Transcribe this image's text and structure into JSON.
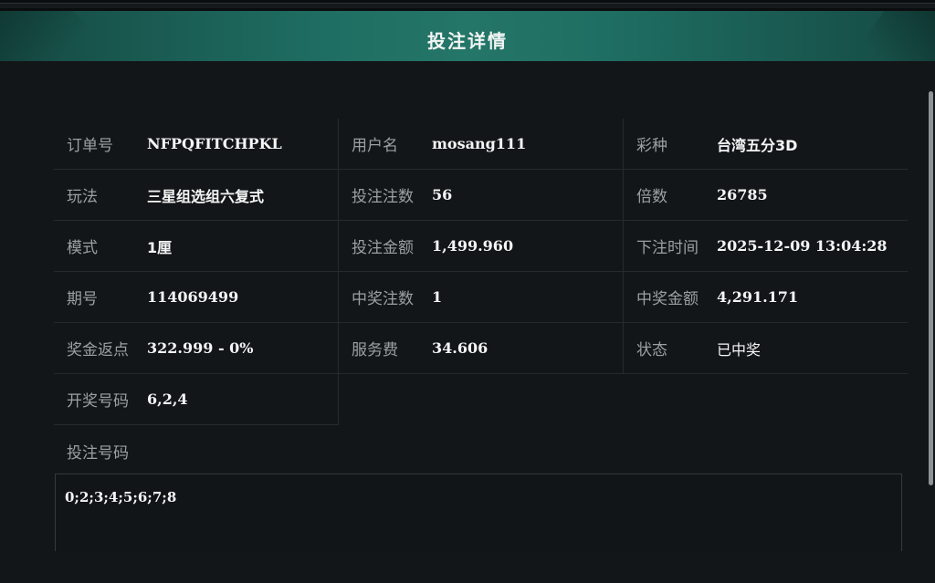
{
  "dialog": {
    "title": "投注详情"
  },
  "rows": [
    [
      {
        "label": "订单号",
        "value": "NFPQFITCHPKL"
      },
      {
        "label": "用户名",
        "value": "mosang111"
      },
      {
        "label": "彩种",
        "value": "台湾五分3D"
      }
    ],
    [
      {
        "label": "玩法",
        "value": "三星组选组六复式"
      },
      {
        "label": "投注注数",
        "value": "56"
      },
      {
        "label": "倍数",
        "value": "26785"
      }
    ],
    [
      {
        "label": "模式",
        "value": "1厘"
      },
      {
        "label": "投注金额",
        "value": "1,499.960"
      },
      {
        "label": "下注时间",
        "value": "2025-12-09 13:04:28"
      }
    ],
    [
      {
        "label": "期号",
        "value": "114069499"
      },
      {
        "label": "中奖注数",
        "value": "1"
      },
      {
        "label": "中奖金额",
        "value": "4,291.171"
      }
    ],
    [
      {
        "label": "奖金返点",
        "value": "322.999 - 0%"
      },
      {
        "label": "服务费",
        "value": "34.606"
      },
      {
        "label": "状态",
        "value": "已中奖"
      }
    ],
    [
      {
        "label": "开奖号码",
        "value": "6,2,4"
      }
    ]
  ],
  "bet_numbers": {
    "label": "投注号码",
    "value": "0;2;3;4;5;6;7;8"
  }
}
